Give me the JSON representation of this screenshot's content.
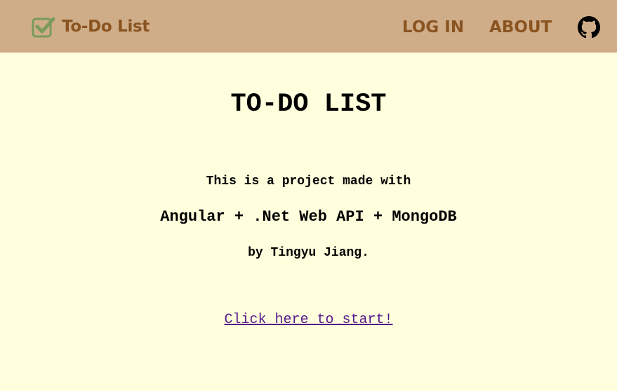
{
  "navbar": {
    "brand_title": "To-Do List",
    "brand_icon": "check-square-icon",
    "login_label": "LOG IN",
    "about_label": "ABOUT",
    "github_icon": "github-icon"
  },
  "main": {
    "title": "TO-DO LIST",
    "desc_line1": "This is a project made with",
    "desc_line2": "Angular + .Net Web API + MongoDB",
    "desc_line3": "by Tingyu Jiang.",
    "start_link": "Click here to start!"
  },
  "colors": {
    "navbar_bg": "#cfad88",
    "page_bg": "#ffffdd",
    "nav_text": "#8a5421",
    "brand_icon": "#7a9b5a",
    "link": "#551a8b"
  }
}
